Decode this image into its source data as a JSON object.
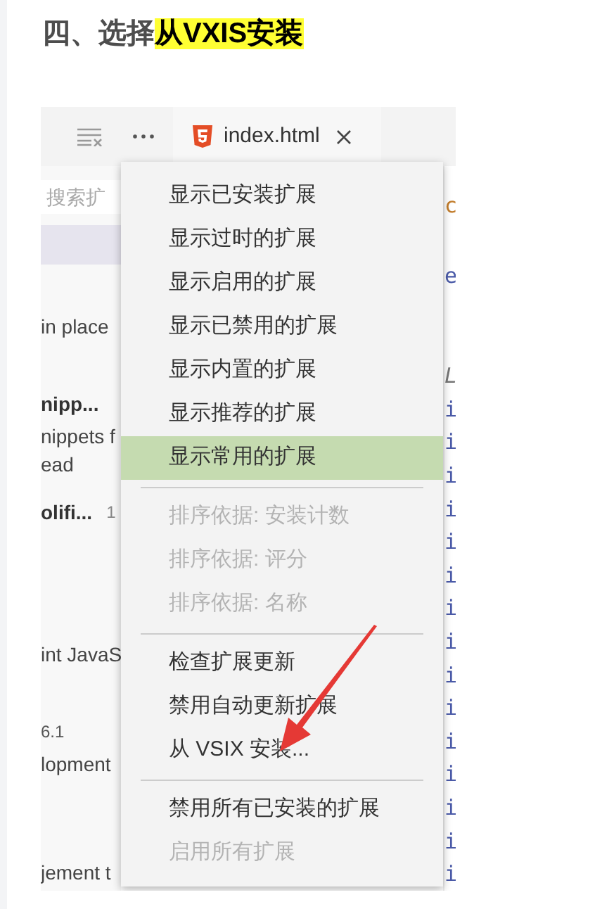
{
  "heading": {
    "text": "四、选择",
    "highlight": "从VXIS安装"
  },
  "editor_tab": {
    "label": "index.html"
  },
  "extensions_panel": {
    "search_placeholder": "搜索扩",
    "lines": [
      {
        "kind": "text",
        "text": "in place"
      },
      {
        "kind": "bold",
        "text": "nipp..."
      },
      {
        "kind": "text",
        "text": "nippets f"
      },
      {
        "kind": "text",
        "text": "ead"
      },
      {
        "kind": "bold",
        "text": "olifi...",
        "extra": "1"
      },
      {
        "kind": "text",
        "text": "int JavaS"
      },
      {
        "kind": "small",
        "text": "6.1"
      },
      {
        "kind": "text",
        "text": "lopment"
      },
      {
        "kind": "text",
        "text": "jement t"
      }
    ]
  },
  "code_column": [
    {
      "kind": "orange",
      "text": "c"
    },
    {
      "kind": "blue",
      "text": "e"
    },
    {
      "kind": "italic",
      "text": "L"
    },
    {
      "kind": "blue",
      "text": "i"
    },
    {
      "kind": "blue",
      "text": "i"
    },
    {
      "kind": "blue",
      "text": "i"
    },
    {
      "kind": "blue",
      "text": "i"
    },
    {
      "kind": "blue",
      "text": "i"
    },
    {
      "kind": "blue",
      "text": "i"
    },
    {
      "kind": "blue",
      "text": "i"
    },
    {
      "kind": "blue",
      "text": "i"
    },
    {
      "kind": "blue",
      "text": "i"
    },
    {
      "kind": "blue",
      "text": "i"
    },
    {
      "kind": "blue",
      "text": "i"
    },
    {
      "kind": "blue",
      "text": "i"
    },
    {
      "kind": "blue",
      "text": "i"
    },
    {
      "kind": "blue",
      "text": "i"
    },
    {
      "kind": "blue",
      "text": "i"
    }
  ],
  "context_menu": {
    "items": [
      {
        "kind": "item",
        "label": "显示已安装扩展",
        "selected": false,
        "disabled": false
      },
      {
        "kind": "item",
        "label": "显示过时的扩展",
        "selected": false,
        "disabled": false
      },
      {
        "kind": "item",
        "label": "显示启用的扩展",
        "selected": false,
        "disabled": false
      },
      {
        "kind": "item",
        "label": "显示已禁用的扩展",
        "selected": false,
        "disabled": false
      },
      {
        "kind": "item",
        "label": "显示内置的扩展",
        "selected": false,
        "disabled": false
      },
      {
        "kind": "item",
        "label": "显示推荐的扩展",
        "selected": false,
        "disabled": false
      },
      {
        "kind": "item",
        "label": "显示常用的扩展",
        "selected": true,
        "disabled": false
      },
      {
        "kind": "divider"
      },
      {
        "kind": "item",
        "label": "排序依据: 安装计数",
        "selected": false,
        "disabled": true
      },
      {
        "kind": "item",
        "label": "排序依据: 评分",
        "selected": false,
        "disabled": true
      },
      {
        "kind": "item",
        "label": "排序依据: 名称",
        "selected": false,
        "disabled": true
      },
      {
        "kind": "divider"
      },
      {
        "kind": "item",
        "label": "检查扩展更新",
        "selected": false,
        "disabled": false
      },
      {
        "kind": "item",
        "label": "禁用自动更新扩展",
        "selected": false,
        "disabled": false
      },
      {
        "kind": "item",
        "label": "从 VSIX 安装...",
        "selected": false,
        "disabled": false
      },
      {
        "kind": "divider"
      },
      {
        "kind": "item",
        "label": "禁用所有已安装的扩展",
        "selected": false,
        "disabled": false
      },
      {
        "kind": "item",
        "label": "启用所有扩展",
        "selected": false,
        "disabled": true
      }
    ]
  }
}
